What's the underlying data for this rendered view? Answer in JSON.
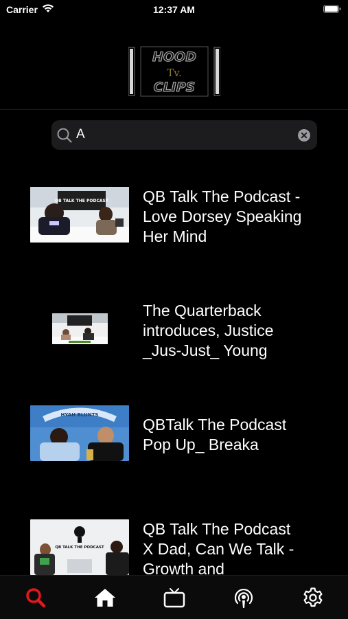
{
  "status_bar": {
    "carrier": "Carrier",
    "time": "12:37 AM"
  },
  "header": {
    "logo_text_line1": "HOOD",
    "logo_text_line2": "Tv.",
    "logo_text_line3": "CLIPS"
  },
  "search": {
    "value": "A",
    "placeholder": ""
  },
  "results": [
    {
      "title": "QB Talk The Podcast -\nLove Dorsey Speaking\nHer Mind",
      "thumb_caption": "QB TALK THE PODCAST"
    },
    {
      "title": "The Quarterback\nintroduces, Justice\n_Jus-Just_ Young",
      "thumb_caption": ""
    },
    {
      "title": "QBTalk The Podcast\nPop Up_ Breaka",
      "thumb_caption": "HYAH BLUNTS"
    },
    {
      "title": "QB Talk The Podcast\nX Dad, Can We Talk -\nGrowth and\nPossibly ...",
      "thumb_caption": "QB TALK THE PODCAST"
    }
  ],
  "tabbar": {
    "tabs": [
      {
        "icon": "search-icon",
        "active": true
      },
      {
        "icon": "home-icon",
        "active": false
      },
      {
        "icon": "tv-icon",
        "active": false
      },
      {
        "icon": "podcast-icon",
        "active": false
      },
      {
        "icon": "gear-icon",
        "active": false
      }
    ],
    "active_color": "#e0191f",
    "inactive_color": "#ffffff"
  }
}
